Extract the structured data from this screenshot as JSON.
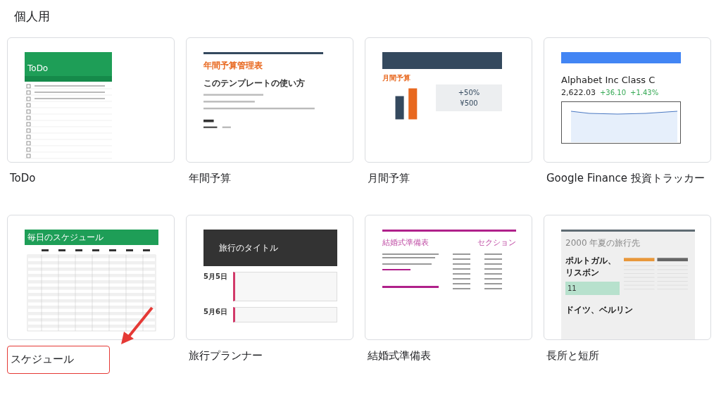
{
  "section_title": "個人用",
  "cards": [
    {
      "title": "ToDo",
      "highlighted": false,
      "thumbnail": {
        "kind": "todo",
        "texts": [
          "ToDo"
        ]
      }
    },
    {
      "title": "年間予算",
      "highlighted": false,
      "thumbnail": {
        "kind": "annual",
        "texts": [
          "年間予算管理表",
          "このテンプレートの使い方"
        ]
      }
    },
    {
      "title": "月間予算",
      "highlighted": false,
      "thumbnail": {
        "kind": "monthly",
        "texts": [
          "月間予算",
          "+50%",
          "¥500"
        ]
      }
    },
    {
      "title": "Google Finance 投資トラッカー",
      "highlighted": false,
      "thumbnail": {
        "kind": "finance",
        "texts": [
          "Alphabet Inc Class C",
          "2,622.03",
          "+36.10",
          "+1.43%"
        ]
      }
    },
    {
      "title": "スケジュール",
      "highlighted": true,
      "thumbnail": {
        "kind": "schedule",
        "texts": [
          "毎日のスケジュール"
        ]
      }
    },
    {
      "title": "旅行プランナー",
      "highlighted": false,
      "thumbnail": {
        "kind": "travel",
        "texts": [
          "旅行のタイトル",
          "5月5日",
          "5月6日"
        ]
      }
    },
    {
      "title": "結婚式準備表",
      "highlighted": false,
      "thumbnail": {
        "kind": "wedding",
        "texts": [
          "結婚式準備表",
          "セクション"
        ]
      }
    },
    {
      "title": "長所と短所",
      "highlighted": false,
      "thumbnail": {
        "kind": "trip",
        "texts": [
          "2000 年夏の旅行先",
          "ポルトガル、リスボン",
          "11",
          "ドイツ、ベルリン"
        ]
      }
    }
  ]
}
